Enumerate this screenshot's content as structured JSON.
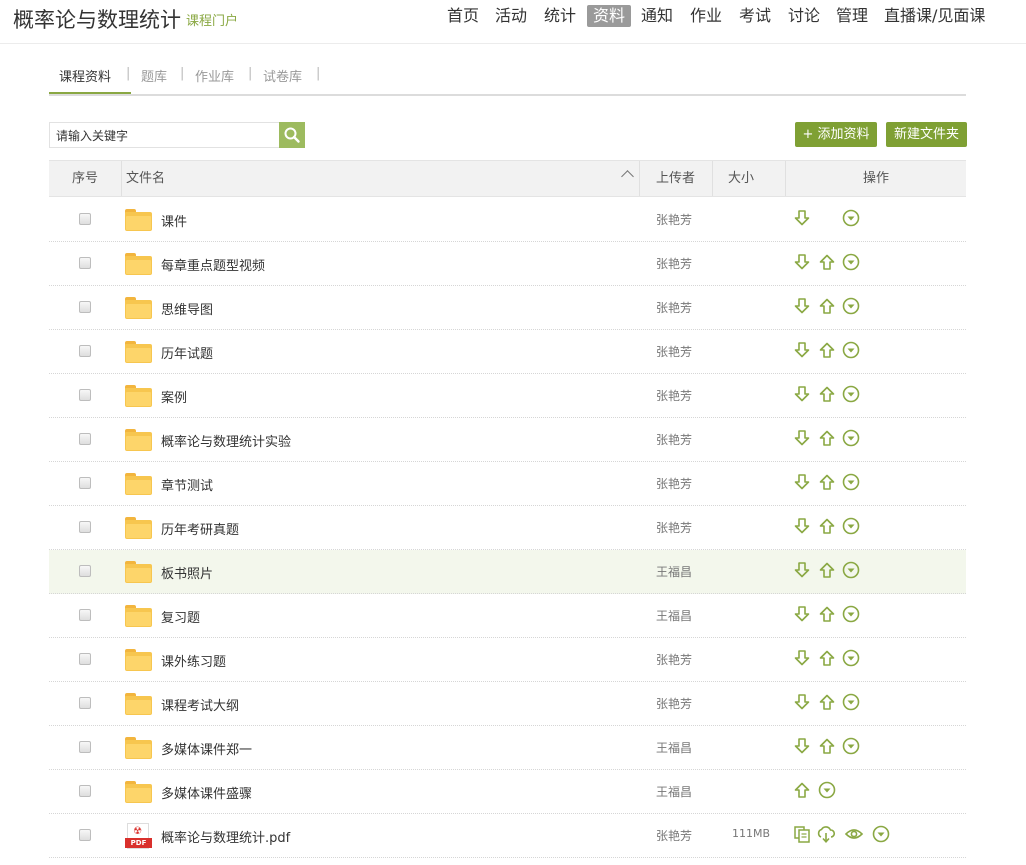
{
  "header": {
    "title": "概率论与数理统计",
    "portal": "课程门户",
    "nav": [
      {
        "label": "首页",
        "name": "nav-home"
      },
      {
        "label": "活动",
        "name": "nav-activity"
      },
      {
        "label": "统计",
        "name": "nav-stats"
      },
      {
        "label": "资料",
        "name": "nav-materials",
        "active": true
      },
      {
        "label": "通知",
        "name": "nav-notice"
      },
      {
        "label": "作业",
        "name": "nav-homework"
      },
      {
        "label": "考试",
        "name": "nav-exam"
      },
      {
        "label": "讨论",
        "name": "nav-discussion"
      },
      {
        "label": "管理",
        "name": "nav-manage"
      },
      {
        "label": "直播课/见面课",
        "name": "nav-live"
      }
    ]
  },
  "subtabs": [
    {
      "label": "课程资料",
      "active": true
    },
    {
      "label": "题库"
    },
    {
      "label": "作业库"
    },
    {
      "label": "试卷库"
    }
  ],
  "search": {
    "placeholder": "请输入关键字",
    "value": ""
  },
  "buttons": {
    "add": "+ 添加资料",
    "new_folder": "新建文件夹"
  },
  "table": {
    "headers": {
      "index": "序号",
      "name": "文件名",
      "uploader": "上传者",
      "size": "大小",
      "ops": "操作"
    },
    "rows": [
      {
        "name": "课件",
        "uploader": "张艳芳",
        "size": "",
        "type": "folder",
        "ops": [
          "download",
          "more"
        ]
      },
      {
        "name": "每章重点题型视频",
        "uploader": "张艳芳",
        "size": "",
        "type": "folder",
        "ops": [
          "download",
          "upload",
          "more"
        ]
      },
      {
        "name": "思维导图",
        "uploader": "张艳芳",
        "size": "",
        "type": "folder",
        "ops": [
          "download",
          "upload",
          "more"
        ]
      },
      {
        "name": "历年试题",
        "uploader": "张艳芳",
        "size": "",
        "type": "folder",
        "ops": [
          "download",
          "upload",
          "more"
        ]
      },
      {
        "name": "案例",
        "uploader": "张艳芳",
        "size": "",
        "type": "folder",
        "ops": [
          "download",
          "upload",
          "more"
        ]
      },
      {
        "name": "概率论与数理统计实验",
        "uploader": "张艳芳",
        "size": "",
        "type": "folder",
        "ops": [
          "download",
          "upload",
          "more"
        ]
      },
      {
        "name": "章节测试",
        "uploader": "张艳芳",
        "size": "",
        "type": "folder",
        "ops": [
          "download",
          "upload",
          "more"
        ]
      },
      {
        "name": "历年考研真题",
        "uploader": "张艳芳",
        "size": "",
        "type": "folder",
        "ops": [
          "download",
          "upload",
          "more"
        ]
      },
      {
        "name": "板书照片",
        "uploader": "王福昌",
        "size": "",
        "type": "folder",
        "ops": [
          "download",
          "upload",
          "more"
        ],
        "highlight": true
      },
      {
        "name": "复习题",
        "uploader": "王福昌",
        "size": "",
        "type": "folder",
        "ops": [
          "download",
          "upload",
          "more"
        ]
      },
      {
        "name": "课外练习题",
        "uploader": "张艳芳",
        "size": "",
        "type": "folder",
        "ops": [
          "download",
          "upload",
          "more"
        ]
      },
      {
        "name": "课程考试大纲",
        "uploader": "张艳芳",
        "size": "",
        "type": "folder",
        "ops": [
          "download",
          "upload",
          "more"
        ]
      },
      {
        "name": "多媒体课件郑一",
        "uploader": "王福昌",
        "size": "",
        "type": "folder",
        "ops": [
          "download",
          "upload",
          "more"
        ]
      },
      {
        "name": "多媒体课件盛骤",
        "uploader": "王福昌",
        "size": "",
        "type": "folder",
        "ops": [
          "upload",
          "more"
        ]
      },
      {
        "name": "概率论与数理统计.pdf",
        "uploader": "张艳芳",
        "size": "111MB",
        "type": "pdf",
        "ops": [
          "copy",
          "cloud-download",
          "preview",
          "more"
        ]
      }
    ]
  },
  "colors": {
    "accent": "#8aa843",
    "button": "#7fa034",
    "icon": "#8aa843"
  }
}
